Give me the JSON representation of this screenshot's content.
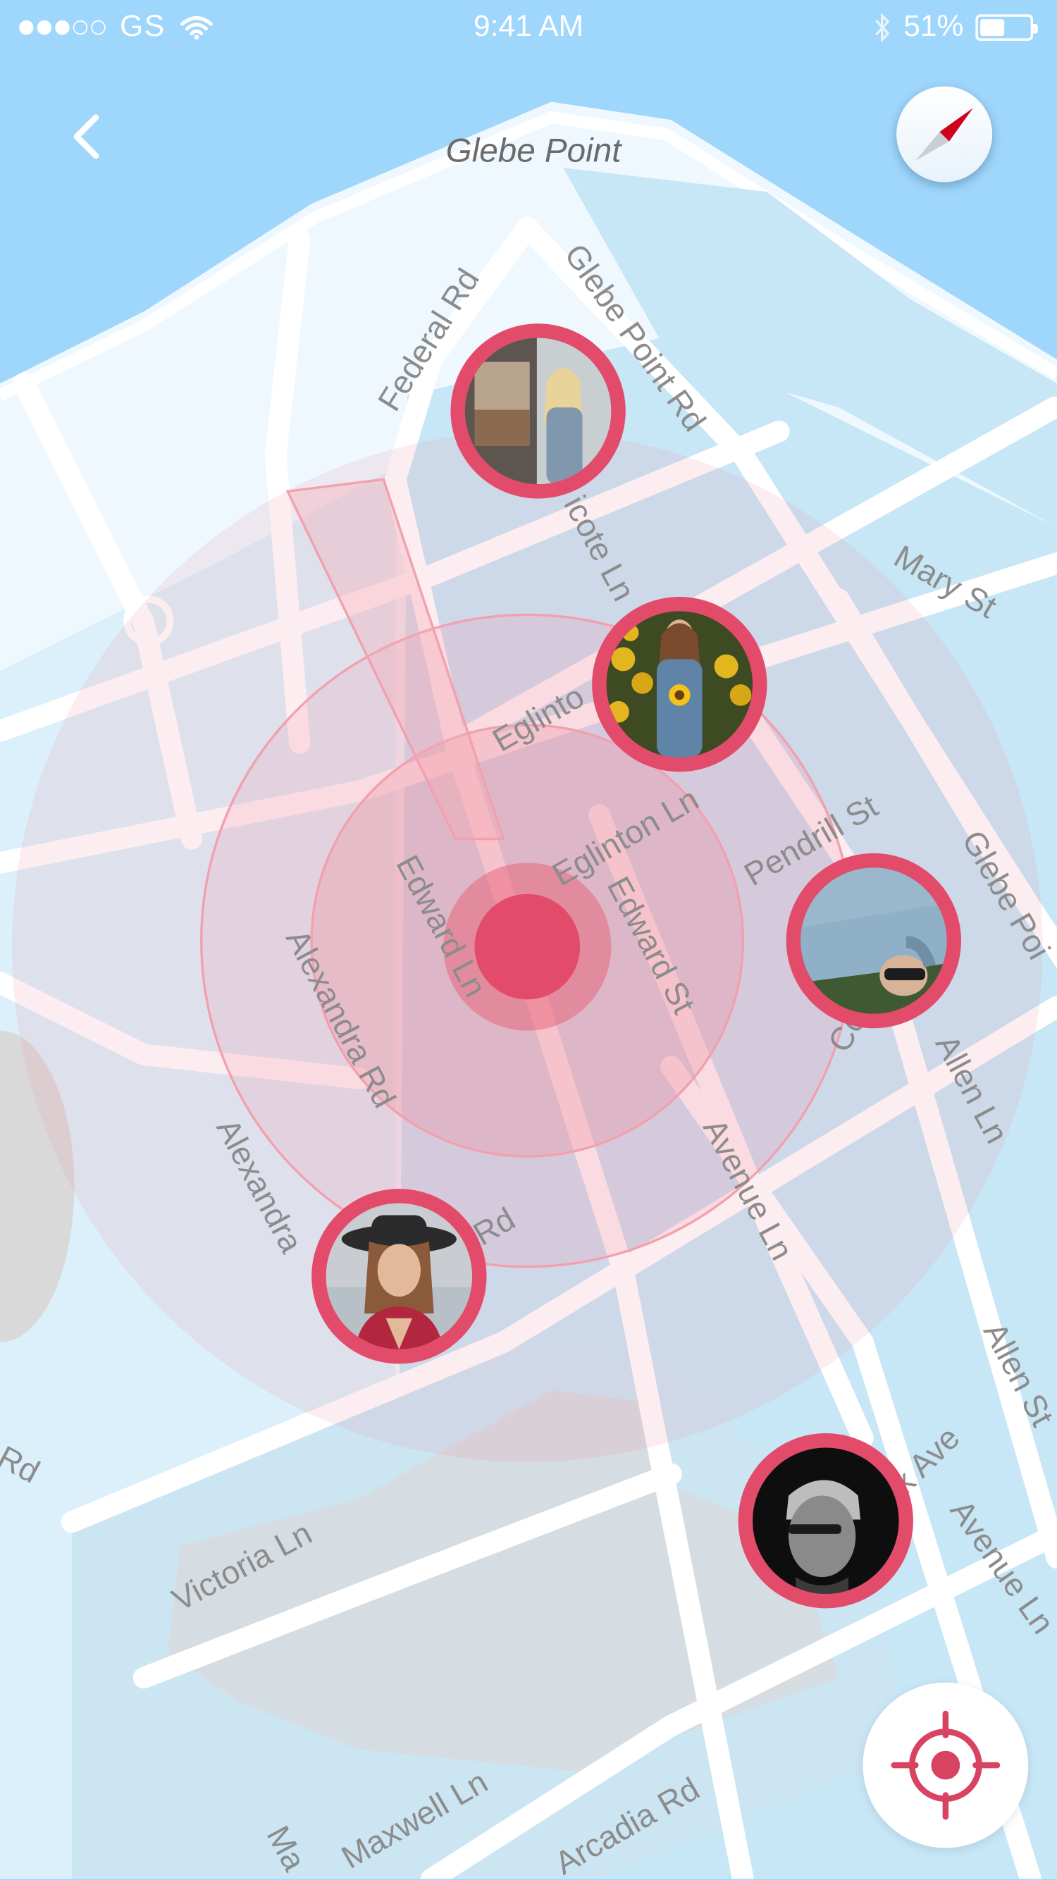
{
  "status_bar": {
    "carrier": "GS",
    "time": "9:41 AM",
    "battery": "51%",
    "battery_level": 0.51
  },
  "map": {
    "title_label": "Glebe Point",
    "street_labels": [
      "Federal Rd",
      "Glebe Point Rd",
      "Mary St",
      "Pendrill St",
      "Eglinton Ln",
      "Edward Ln",
      "Edward St",
      "Alexandra Rd",
      "Alexandra",
      "Avenue Ln",
      "Allen Ln",
      "Allen St",
      "Victoria Ln",
      "Maxwell Ln",
      "Arcadia Rd",
      "Cook St",
      "Rd",
      "k Ave",
      "Avenue Ln",
      "Glebe Poi",
      "Eglinto",
      "Rd",
      "Ma",
      "icote Ln"
    ]
  },
  "icons": {
    "back": "chevron-left-icon",
    "compass": "compass-icon",
    "locate": "crosshair-icon",
    "wifi": "wifi-icon",
    "bluetooth": "bluetooth-icon",
    "battery": "battery-icon"
  },
  "colors": {
    "accent": "#e34b6a",
    "water": "#9fd6fb",
    "land": "#d9ecf8",
    "radar": "#f29aa9"
  },
  "people": [
    {
      "name_id": "person-1",
      "avatar": "woman-window-portrait"
    },
    {
      "name_id": "person-2",
      "avatar": "woman-sunflower-field"
    },
    {
      "name_id": "person-3",
      "avatar": "man-lying-grass-sunglasses"
    },
    {
      "name_id": "person-4",
      "avatar": "woman-black-hat"
    },
    {
      "name_id": "person-5",
      "avatar": "man-monochrome-profile"
    }
  ]
}
